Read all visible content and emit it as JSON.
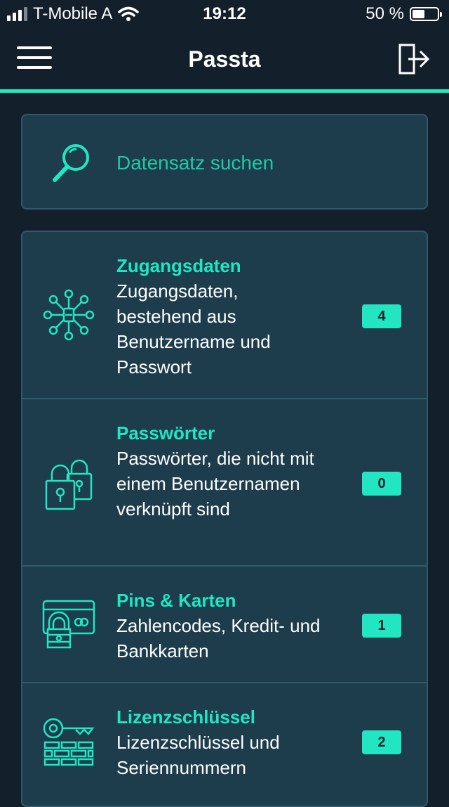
{
  "status_bar": {
    "carrier": "T-Mobile A",
    "time": "19:12",
    "battery_percent": "50 %",
    "battery_level": 0.5
  },
  "header": {
    "title": "Passta",
    "menu_icon": "hamburger-menu-icon",
    "logout_icon": "logout-icon"
  },
  "search": {
    "placeholder": "Datensatz suchen",
    "icon": "search-icon"
  },
  "categories": [
    {
      "title": "Zugangsdaten",
      "description": "Zugangsdaten, bestehend aus Benutzername und Passwort",
      "count": "4",
      "icon": "network-nodes-icon"
    },
    {
      "title": "Passwörter",
      "description": "Passwörter, die nicht mit einem Benutzernamen verknüpft sind",
      "count": "0",
      "icon": "padlocks-icon"
    },
    {
      "title": "Pins & Karten",
      "description": "Zahlencodes, Kredit- und Bankkarten",
      "count": "1",
      "icon": "card-lock-icon"
    },
    {
      "title": "Lizenzschlüssel",
      "description": "Lizenzschlüssel und Seriennummern",
      "count": "2",
      "icon": "key-bricks-icon"
    }
  ],
  "colors": {
    "background": "#13202b",
    "panel": "#1d3d4c",
    "accent": "#21e6c1"
  }
}
